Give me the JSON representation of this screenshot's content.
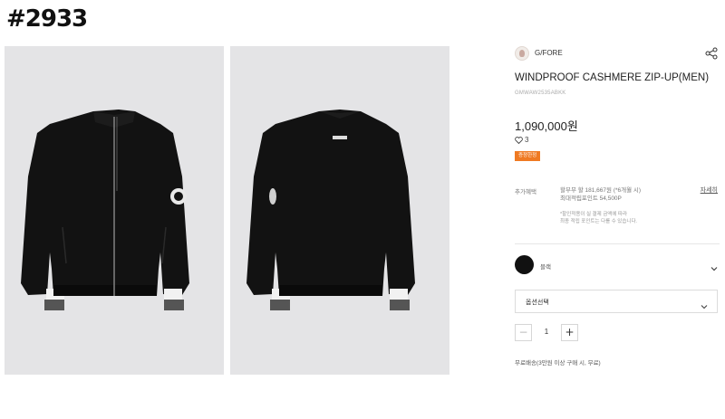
{
  "post_tag": "#2933",
  "product": {
    "brand_name": "G/FORE",
    "name": "WINDPROOF CASHMERE ZIP-UP(MEN)",
    "code": "GMWAW2535ABKK",
    "price": "1,090,000원",
    "likes": "3",
    "badge": "증정한정"
  },
  "benefits": {
    "label": "추가혜택",
    "line1": "할부무 할 181,667원 (*6개월 시)",
    "line2": "최대적립포인트 54,500P",
    "note1": "*할인적용이 실 결제 금액에 따라",
    "note2": "최종 적립 포인트는 다를 수 있습니다.",
    "detail_link": "자세히"
  },
  "color": {
    "name": "블랙",
    "swatch": "#111111"
  },
  "option": {
    "placeholder": "옵션선택"
  },
  "quantity": {
    "value": "1",
    "minus": "−",
    "plus": "+"
  },
  "shipping": "무료배송(3만원 이상 구매 시, 무료)",
  "icons": {
    "share": "share-icon",
    "heart": "heart-icon",
    "chevron": "chevron-down-icon"
  },
  "colors": {
    "accent_badge": "#ef7a23",
    "photo_bg": "#e4e4e6"
  }
}
